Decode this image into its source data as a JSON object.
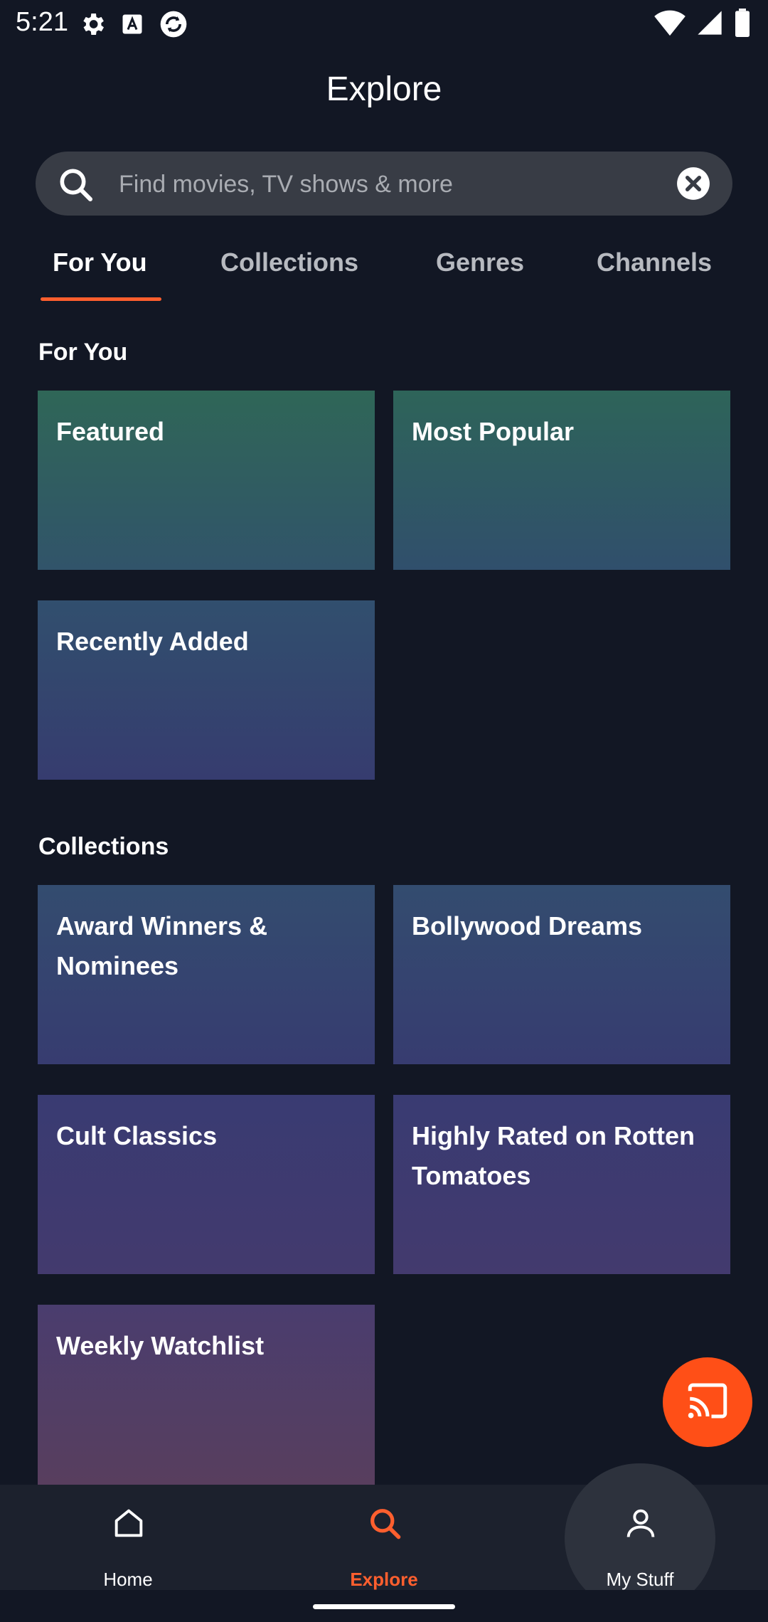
{
  "status_bar": {
    "time": "5:21",
    "icons_left": [
      "gear-icon",
      "text-a-icon",
      "sync-app-icon"
    ],
    "icons_right": [
      "wifi-icon",
      "signal-icon",
      "battery-icon"
    ]
  },
  "header": {
    "title": "Explore"
  },
  "search": {
    "placeholder": "Find movies, TV shows & more",
    "value": ""
  },
  "tabs": [
    {
      "label": "For You",
      "active": true
    },
    {
      "label": "Collections",
      "active": false
    },
    {
      "label": "Genres",
      "active": false
    },
    {
      "label": "Channels",
      "active": false
    }
  ],
  "sections": {
    "for_you": {
      "title": "For You",
      "cards": [
        {
          "label": "Featured"
        },
        {
          "label": "Most Popular"
        },
        {
          "label": "Recently Added"
        }
      ]
    },
    "collections": {
      "title": "Collections",
      "cards": [
        {
          "label": "Award Winners & Nominees"
        },
        {
          "label": "Bollywood Dreams"
        },
        {
          "label": "Cult Classics"
        },
        {
          "label": "Highly Rated on Rotten Tomatoes"
        },
        {
          "label": "Weekly Watchlist"
        }
      ]
    }
  },
  "bottom_nav": {
    "items": [
      {
        "label": "Home",
        "icon": "home-icon",
        "active": false
      },
      {
        "label": "Explore",
        "icon": "search-icon",
        "active": true
      },
      {
        "label": "My Stuff",
        "icon": "person-icon",
        "active": false
      }
    ]
  },
  "colors": {
    "background": "#121724",
    "accent": "#ff5f2e",
    "cast_button": "#ff4f17",
    "nav_background": "#1c212d"
  }
}
